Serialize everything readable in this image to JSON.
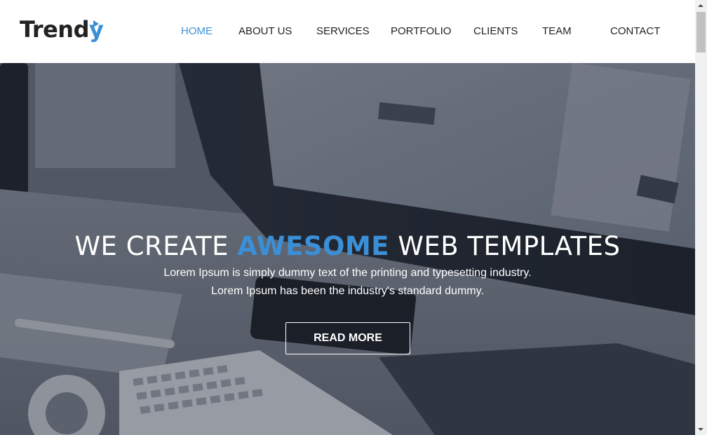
{
  "header": {
    "logo": {
      "main": "Trend",
      "accent_letter": "y"
    },
    "nav": [
      {
        "label": "HOME",
        "active": true
      },
      {
        "label": "ABOUT US",
        "active": false
      },
      {
        "label": "SERVICES",
        "active": false
      },
      {
        "label": "PORTFOLIO",
        "active": false
      },
      {
        "label": "CLIENTS",
        "active": false
      },
      {
        "label": "TEAM",
        "active": false
      },
      {
        "label": "CONTACT",
        "active": false
      }
    ]
  },
  "hero": {
    "title_before": "WE CREATE ",
    "title_highlight": "AWESOME",
    "title_after": " WEB TEMPLATES",
    "line1": "Lorem Ipsum is simply dummy text of the printing and typesetting industry.",
    "line2": "Lorem Ipsum has been the industry's standard dummy.",
    "button_label": "READ MORE"
  },
  "colors": {
    "accent": "#3a8fd6",
    "text_dark": "#222222",
    "header_bg": "#ffffff"
  },
  "icons": {
    "logo_mark": "triangle-arrow-icon",
    "scroll_up": "caret-up-icon",
    "scroll_down": "caret-down-icon"
  }
}
